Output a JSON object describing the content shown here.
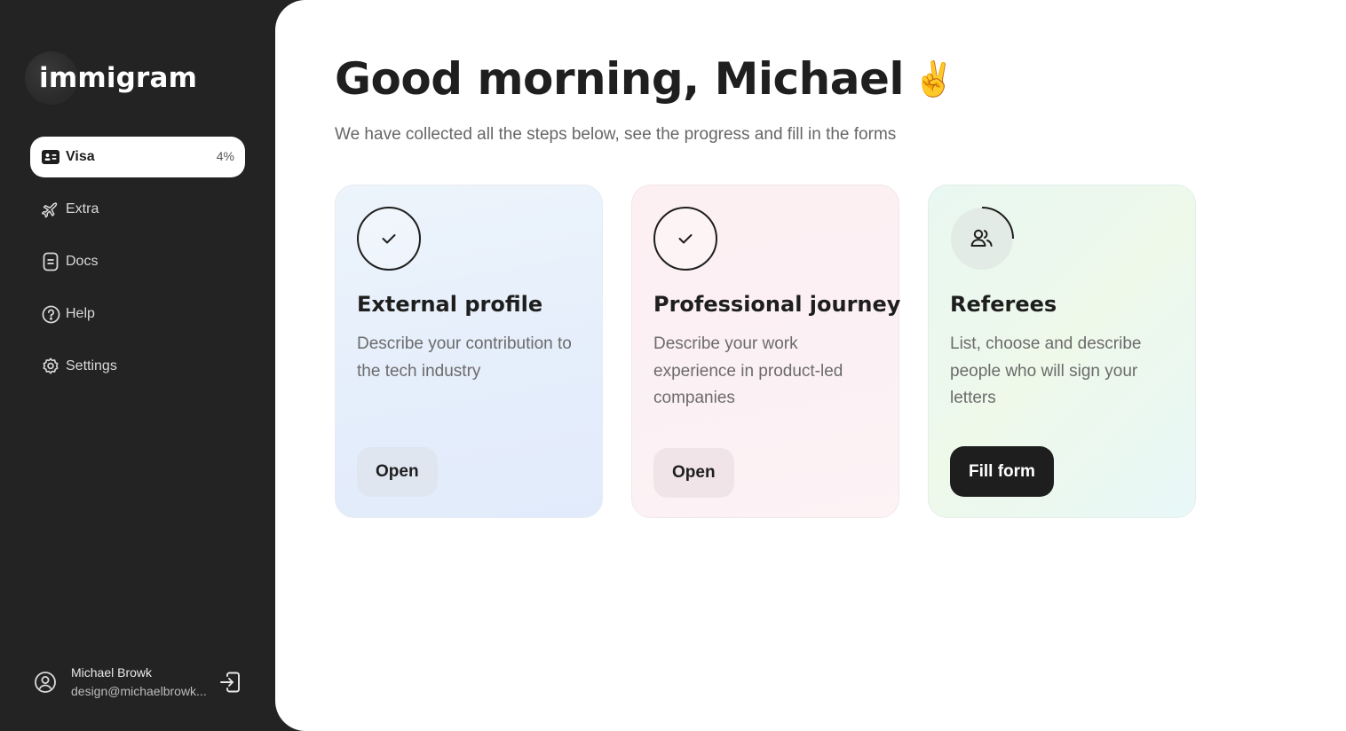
{
  "app": {
    "brand": "immigram"
  },
  "sidebar": {
    "items": [
      {
        "label": "Visa",
        "icon": "id-card-icon",
        "badge": "4%",
        "active": true
      },
      {
        "label": "Extra",
        "icon": "airplane-icon"
      },
      {
        "label": "Docs",
        "icon": "document-icon"
      },
      {
        "label": "Help",
        "icon": "question-icon"
      },
      {
        "label": "Settings",
        "icon": "gear-icon"
      }
    ],
    "user": {
      "name": "Michael Browk",
      "email": "design@michaelbrowk..."
    }
  },
  "main": {
    "greeting": "Good morning, Michael",
    "greeting_emoji": "✌️",
    "subtitle": "We have collected all the steps below, see the progress and fill in the forms",
    "cards": [
      {
        "title": "External profile",
        "description": "Describe your contribution to the tech industry",
        "button": "Open",
        "status": "complete",
        "icon": "check-icon",
        "progress": 1.0
      },
      {
        "title": "Professional journey",
        "description": "Describe your work experience in product-led companies",
        "button": "Open",
        "status": "complete",
        "icon": "check-icon",
        "progress": 1.0
      },
      {
        "title": "Referees",
        "description": "List, choose and describe people who will sign your letters",
        "button": "Fill form",
        "status": "in-progress",
        "icon": "users-icon",
        "progress": 0.25
      }
    ]
  },
  "colors": {
    "sidebar_bg": "#232323",
    "accent_dark": "#1e1e1e",
    "card_blue": "#e5eefb",
    "card_pink": "#fbf0f4",
    "card_green": "#eaf8ee"
  }
}
